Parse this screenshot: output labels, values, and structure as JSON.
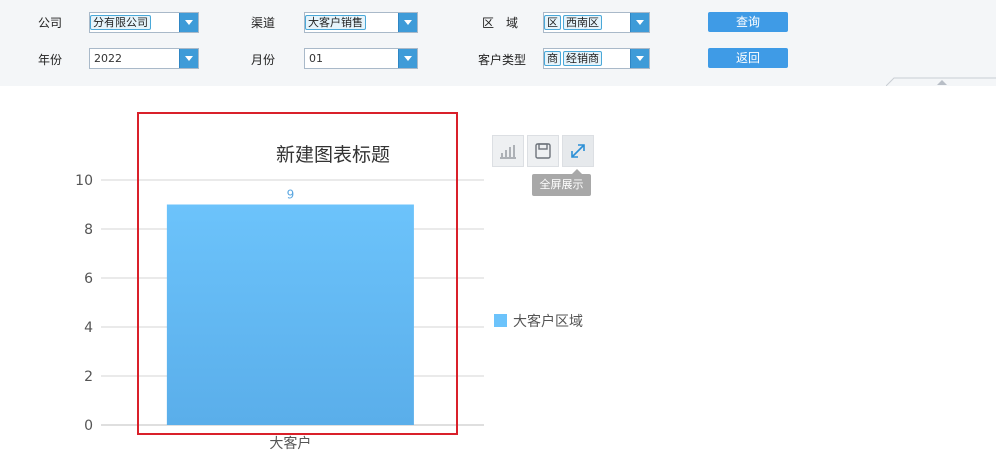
{
  "filters": {
    "company": {
      "label": "公司",
      "value": "分有限公司"
    },
    "channel": {
      "label": "渠道",
      "value": "大客户销售"
    },
    "region": {
      "label": "区　域",
      "tags": [
        "区",
        "西南区"
      ]
    },
    "year": {
      "label": "年份",
      "value": "2022"
    },
    "month": {
      "label": "月份",
      "value": "01"
    },
    "customer_type": {
      "label": "客户类型",
      "tags": [
        "商",
        "经销商"
      ]
    }
  },
  "buttons": {
    "query": "查询",
    "back": "返回"
  },
  "toolbar": {
    "fullscreen_tooltip": "全屏展示"
  },
  "colors": {
    "bar_top": "#6cc3fb",
    "bar_bottom": "#5aaeea",
    "accent": "#3f9be6",
    "selection": "#d9202a"
  },
  "chart_data": {
    "type": "bar",
    "title": "新建图表标题",
    "categories": [
      "大客户"
    ],
    "series": [
      {
        "name": "大客户区域",
        "values": [
          9
        ]
      }
    ],
    "ylim": [
      0,
      10
    ],
    "yticks": [
      "0",
      "2",
      "4",
      "6",
      "8",
      "10"
    ],
    "data_labels": [
      "9"
    ],
    "grid": true,
    "legend": "right"
  }
}
